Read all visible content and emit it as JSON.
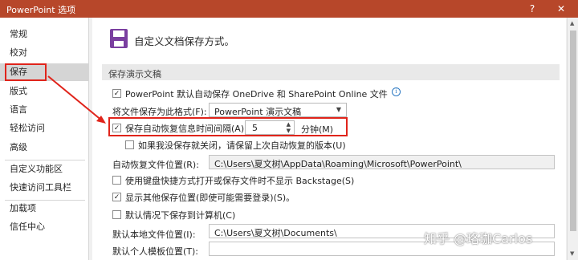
{
  "window": {
    "title": "PowerPoint 选项",
    "help_label": "?",
    "close_label": "✕",
    "accent_color": "#b7472a"
  },
  "sidebar": {
    "items": [
      {
        "label": "常规"
      },
      {
        "label": "校对"
      },
      {
        "label": "保存",
        "selected": true
      },
      {
        "label": "版式"
      },
      {
        "label": "语言"
      },
      {
        "label": "轻松访问"
      },
      {
        "label": "高级"
      },
      {
        "label": "自定义功能区"
      },
      {
        "label": "快速访问工具栏"
      },
      {
        "label": "加载项"
      },
      {
        "label": "信任中心"
      }
    ]
  },
  "header": {
    "icon": "save-icon",
    "title": "自定义文档保存方式。"
  },
  "section": {
    "title": "保存演示文稿"
  },
  "options": {
    "autosave_onedrive": {
      "label": "PowerPoint 默认自动保存 OneDrive 和 SharePoint Online 文件",
      "checked": true,
      "info_icon": "info-icon"
    },
    "save_format": {
      "label": "将文件保存为此格式(F):",
      "value": "PowerPoint 演示文稿"
    },
    "autorecover_interval": {
      "label": "保存自动恢复信息时间间隔(A)",
      "checked": true,
      "value": "5",
      "unit": "分钟(M)"
    },
    "keep_last_version": {
      "label": "如果我没保存就关闭，请保留上次自动恢复的版本(U)",
      "checked": false
    },
    "autorecover_location": {
      "label": "自动恢复文件位置(R):",
      "value": "C:\\Users\\夏文树\\AppData\\Roaming\\Microsoft\\PowerPoint\\"
    },
    "no_backstage": {
      "label": "使用键盘快捷方式打开或保存文件时不显示 Backstage(S)",
      "checked": false
    },
    "show_other_locations": {
      "label": "显示其他保存位置(即使可能需要登录)(S)。",
      "checked": true
    },
    "save_to_computer": {
      "label": "默认情况下保存到计算机(C)",
      "checked": false
    },
    "default_local_location": {
      "label": "默认本地文件位置(I):",
      "value": "C:\\Users\\夏文树\\Documents\\"
    },
    "personal_templates": {
      "label": "默认个人模板位置(T):",
      "value": ""
    }
  },
  "watermark": "知乎 @珞珈Carlos",
  "highlight_color": "#e0241b"
}
